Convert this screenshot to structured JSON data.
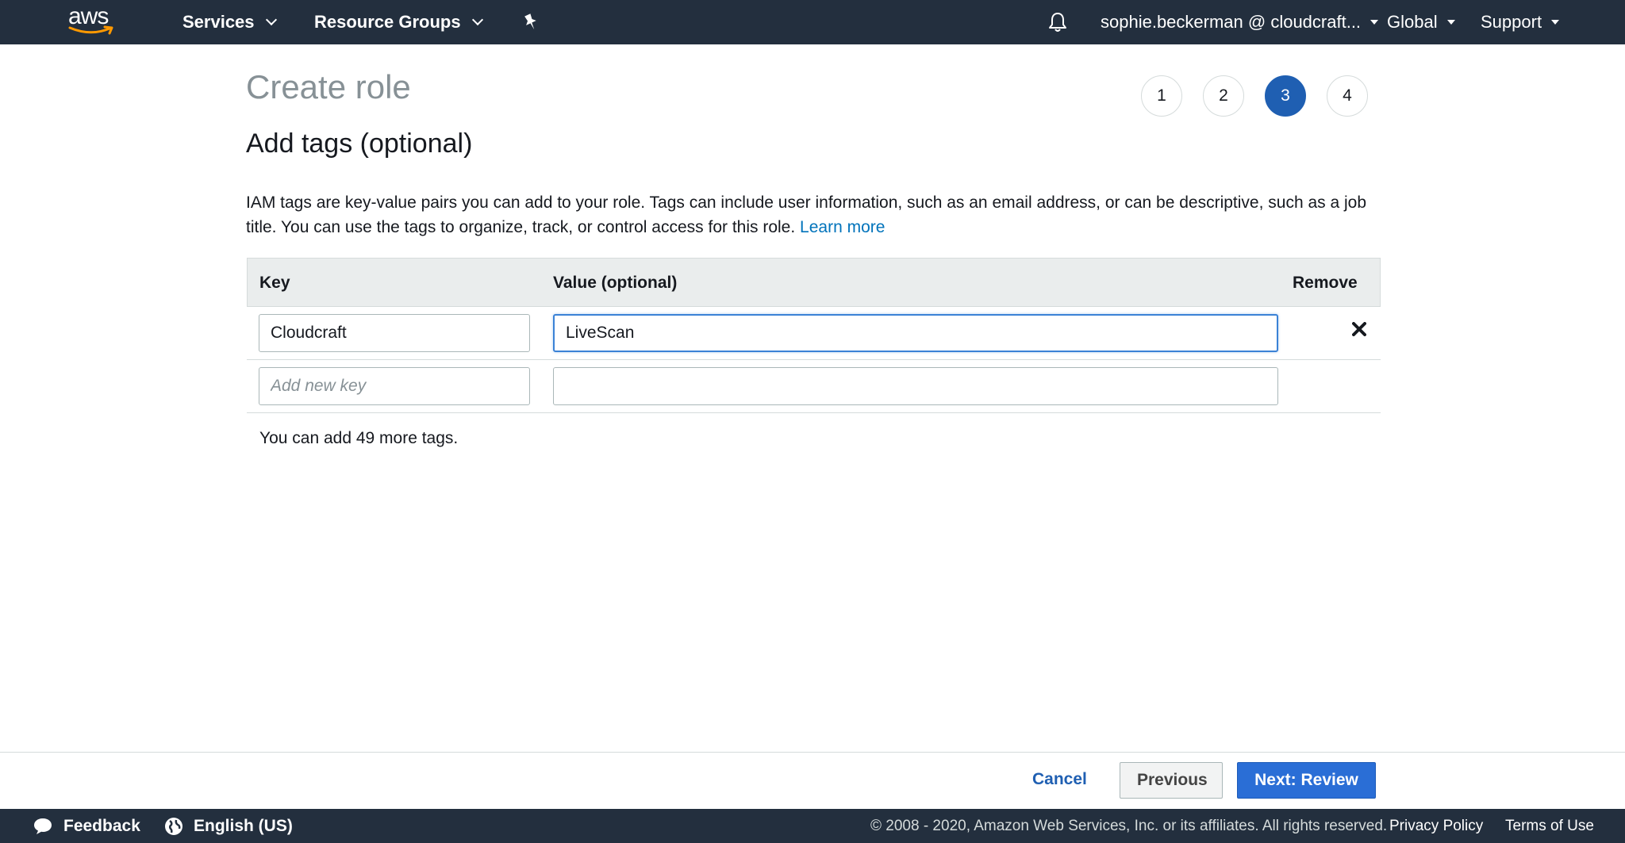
{
  "nav": {
    "logo_text": "aws",
    "services": "Services",
    "resource_groups": "Resource Groups",
    "account": "sophie.beckerman @ cloudcraft...",
    "region": "Global",
    "support": "Support"
  },
  "page": {
    "title": "Create role",
    "steps": [
      "1",
      "2",
      "3",
      "4"
    ],
    "active_step": "3",
    "section_title": "Add tags (optional)",
    "description": "IAM tags are key-value pairs you can add to your role. Tags can include user information, such as an email address, or can be descriptive, such as a job title. You can use the tags to organize, track, or control access for this role.",
    "learn_more": "Learn more"
  },
  "tags_table": {
    "headers": {
      "key": "Key",
      "value": "Value (optional)",
      "remove": "Remove"
    },
    "rows": [
      {
        "key": "Cloudcraft",
        "value": "LiveScan"
      }
    ],
    "new_key_placeholder": "Add new key",
    "remaining_text": "You can add 49 more tags."
  },
  "actions": {
    "cancel": "Cancel",
    "previous": "Previous",
    "next": "Next: Review"
  },
  "footer": {
    "feedback": "Feedback",
    "language": "English (US)",
    "copyright": "© 2008 - 2020, Amazon Web Services, Inc. or its affiliates. All rights reserved.",
    "privacy": "Privacy Policy",
    "terms": "Terms of Use"
  },
  "colors": {
    "nav_bg": "#232f3e",
    "primary": "#2a6ed6",
    "active_step": "#1f5fb2",
    "link": "#0073bb",
    "aws_orange": "#ff9900"
  }
}
